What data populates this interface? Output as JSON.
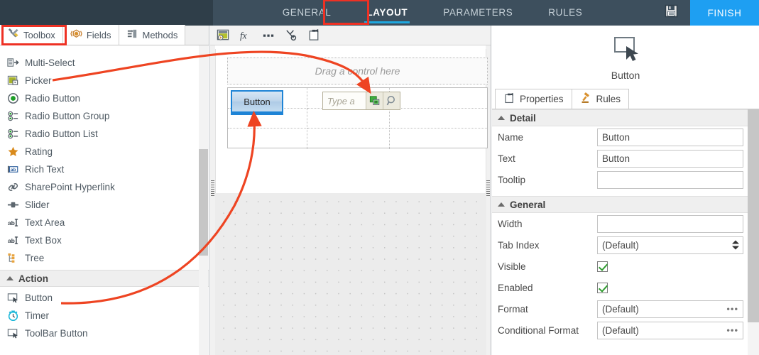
{
  "topbar": {
    "nav": [
      {
        "label": "GENERAL",
        "active": false
      },
      {
        "label": "LAYOUT",
        "active": true
      },
      {
        "label": "PARAMETERS",
        "active": false
      },
      {
        "label": "RULES",
        "active": false
      }
    ],
    "save_icon": "save-floppy-icon",
    "finish_label": "FINISH",
    "accent_color": "#1e9ff2",
    "bar_color": "#3d4f5d",
    "highlight_color": "#ee3124"
  },
  "left_panel": {
    "tabs": [
      {
        "label": "Toolbox",
        "icon": "tools-icon",
        "active": true,
        "highlighted": true
      },
      {
        "label": "Fields",
        "icon": "fields-icon",
        "active": false,
        "highlighted": false
      },
      {
        "label": "Methods",
        "icon": "methods-icon",
        "active": false,
        "highlighted": false
      }
    ],
    "items": [
      {
        "label": "Multi-Select",
        "icon": "multi-select-icon"
      },
      {
        "label": "Picker",
        "icon": "picker-icon"
      },
      {
        "label": "Radio Button",
        "icon": "radio-button-icon"
      },
      {
        "label": "Radio Button Group",
        "icon": "radio-button-group-icon"
      },
      {
        "label": "Radio Button List",
        "icon": "radio-button-list-icon"
      },
      {
        "label": "Rating",
        "icon": "star-icon"
      },
      {
        "label": "Rich Text",
        "icon": "rich-text-icon"
      },
      {
        "label": "SharePoint Hyperlink",
        "icon": "link-icon"
      },
      {
        "label": "Slider",
        "icon": "slider-icon"
      },
      {
        "label": "Text Area",
        "icon": "text-area-icon"
      },
      {
        "label": "Text Box",
        "icon": "text-box-icon"
      },
      {
        "label": "Tree",
        "icon": "tree-icon"
      }
    ],
    "action_group": {
      "label": "Action",
      "items": [
        {
          "label": "Button",
          "icon": "button-icon"
        },
        {
          "label": "Timer",
          "icon": "timer-icon"
        },
        {
          "label": "ToolBar Button",
          "icon": "toolbar-button-icon"
        }
      ]
    }
  },
  "center_panel": {
    "toolbar_icons": [
      "view-image-icon",
      "function-fx-icon",
      "ellipsis-icon",
      "cut-refresh-icon",
      "properties-clipboard-icon"
    ],
    "drop_zone_text": "Drag a control here",
    "design_button_label": "Button",
    "picker_placeholder": "Type a",
    "picker_buttons": [
      "picker-select-icon",
      "picker-search-icon"
    ]
  },
  "right_panel": {
    "header": {
      "icon": "button-icon",
      "label": "Button"
    },
    "tabs": [
      {
        "label": "Properties",
        "icon": "properties-clipboard-icon",
        "active": true
      },
      {
        "label": "Rules",
        "icon": "gavel-icon",
        "active": false
      }
    ],
    "sections": [
      {
        "title": "Detail",
        "rows": [
          {
            "label": "Name",
            "type": "text",
            "value": "Button"
          },
          {
            "label": "Text",
            "type": "text",
            "value": "Button"
          },
          {
            "label": "Tooltip",
            "type": "text",
            "value": ""
          }
        ]
      },
      {
        "title": "General",
        "rows": [
          {
            "label": "Width",
            "type": "text",
            "value": ""
          },
          {
            "label": "Tab Index",
            "type": "spinner",
            "value": "(Default)"
          },
          {
            "label": "Visible",
            "type": "checkbox",
            "value": "checked"
          },
          {
            "label": "Enabled",
            "type": "checkbox",
            "value": "checked"
          },
          {
            "label": "Format",
            "type": "ellipsis",
            "value": "(Default)"
          },
          {
            "label": "Conditional Format",
            "type": "ellipsis",
            "value": "(Default)"
          }
        ]
      }
    ]
  },
  "annotations": {
    "arrow_color": "#ee4422",
    "arrow_from_picker_label": "arrow-picker-to-canvas",
    "arrow_from_button_label": "arrow-button-to-canvas"
  }
}
